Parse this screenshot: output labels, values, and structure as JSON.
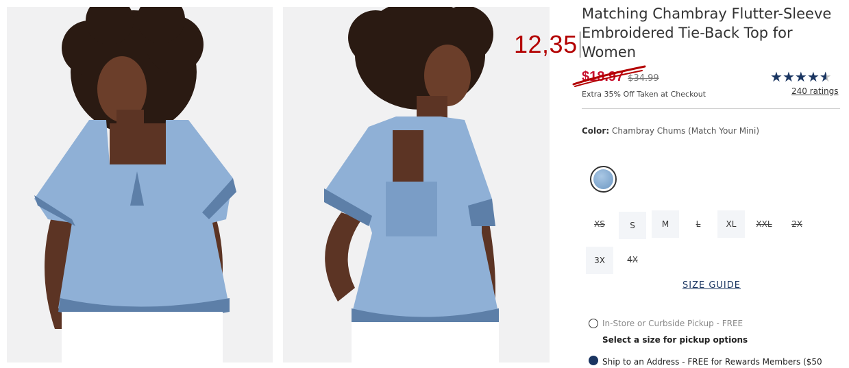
{
  "product": {
    "title": "Matching Chambray Flutter-Sleeve Embroidered Tie-Back Top for Women",
    "sale_price": "$18.97",
    "original_price": "$34.99",
    "promo_text": "Extra 35% Off Taken at Checkout",
    "rating_value": 4.5,
    "ratings_link": "240 ratings"
  },
  "annotation": {
    "handwritten_price": "12,35"
  },
  "color": {
    "label": "Color:",
    "value": "Chambray Chums (Match Your Mini)",
    "swatch_color": "#8fb3d8"
  },
  "sizes": [
    {
      "label": "XS",
      "available": false
    },
    {
      "label": "S",
      "available": true
    },
    {
      "label": "M",
      "available": true
    },
    {
      "label": "L",
      "available": false
    },
    {
      "label": "XL",
      "available": true
    },
    {
      "label": "XXL",
      "available": false
    },
    {
      "label": "2X",
      "available": false
    },
    {
      "label": "3X",
      "available": true
    },
    {
      "label": "4X",
      "available": false
    }
  ],
  "size_guide": "SIZE GUIDE",
  "fulfillment": {
    "pickup_label": "In-Store or Curbside Pickup - FREE",
    "pickup_note": "Select a size for pickup options",
    "ship_label": "Ship to an Address - FREE for Rewards Members ($50"
  },
  "colors": {
    "sale_red": "#c8102e",
    "annotation_red": "#b30000",
    "brand_navy": "#1a3561",
    "shirt_blue": "#8fb0d6"
  }
}
